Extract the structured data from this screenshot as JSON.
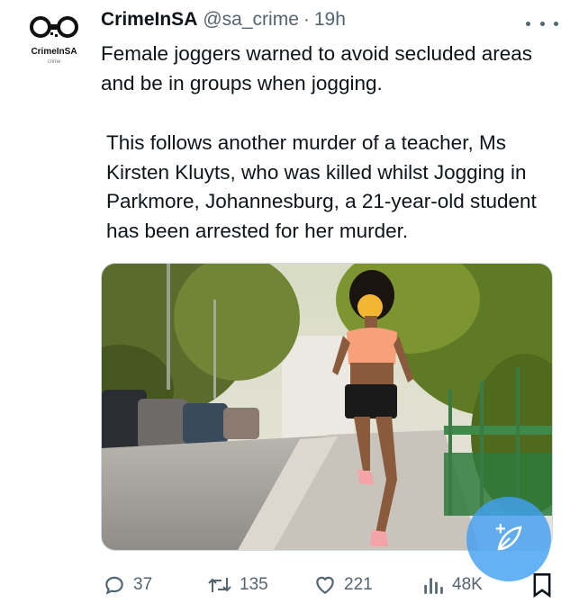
{
  "account": {
    "display_name": "CrimeInSA",
    "handle": "@sa_crime",
    "separator": "·",
    "time": "19h",
    "avatar_brand": "CrimeInSA",
    "avatar_sub": "crime"
  },
  "tweet": {
    "paragraph1": "Female joggers warned to avoid secluded areas and be in groups when jogging.",
    "paragraph2": "This follows another murder of a teacher, Ms Kirsten Kluyts, who was killed whilst Jogging in Parkmore, Johannesburg, a 21-year-old student has been arrested for her murder."
  },
  "actions": {
    "replies": "37",
    "retweets": "135",
    "likes": "221",
    "views": "48K"
  },
  "icons": {
    "more": "more-dots-icon",
    "reply": "reply-icon",
    "retweet": "retweet-icon",
    "like": "heart-icon",
    "views": "views-chart-icon",
    "bookmark": "bookmark-icon",
    "compose": "compose-icon"
  },
  "colors": {
    "text": "#0f1419",
    "secondary": "#536471",
    "accent": "#1d9bf0"
  }
}
